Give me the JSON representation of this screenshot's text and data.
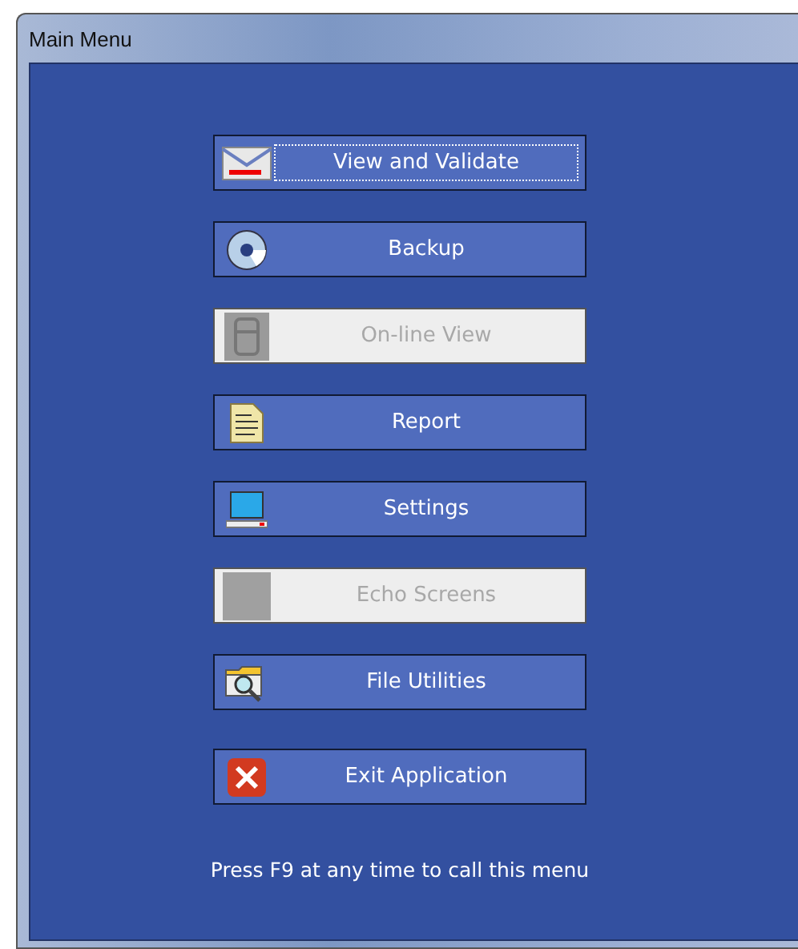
{
  "window": {
    "title": "Main Menu"
  },
  "buttons": [
    {
      "label": "View and Validate",
      "disabled": false,
      "focused": true
    },
    {
      "label": "Backup",
      "disabled": false,
      "focused": false
    },
    {
      "label": "On-line View",
      "disabled": true,
      "focused": false
    },
    {
      "label": "Report",
      "disabled": false,
      "focused": false
    },
    {
      "label": "Settings",
      "disabled": false,
      "focused": false
    },
    {
      "label": "Echo Screens",
      "disabled": true,
      "focused": false
    },
    {
      "label": "File Utilities",
      "disabled": false,
      "focused": false
    },
    {
      "label": "Exit Application",
      "disabled": false,
      "focused": false
    }
  ],
  "hint": "Press F9 at any time to call this menu"
}
